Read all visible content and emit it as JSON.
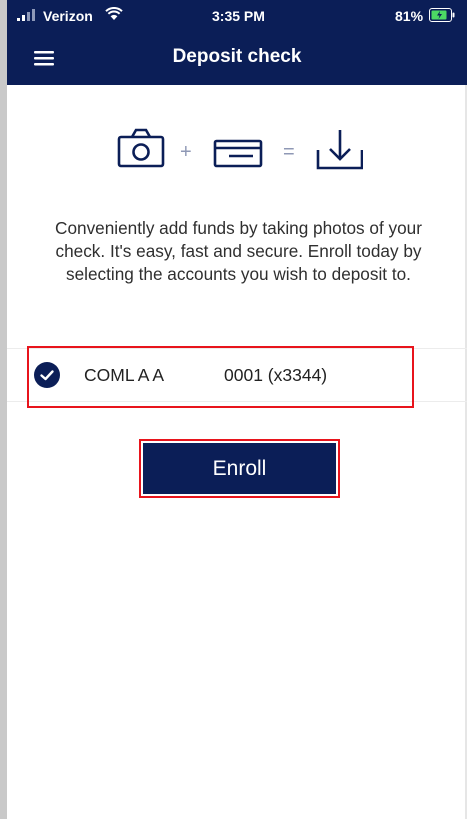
{
  "status_bar": {
    "carrier": "Verizon",
    "time": "3:35 PM",
    "battery_percent": "81%"
  },
  "header": {
    "title": "Deposit check",
    "menu_icon": "hamburger-menu-icon",
    "background_color": "#0b1e57"
  },
  "hero": {
    "icons": [
      "camera-icon",
      "check-card-icon",
      "download-icon"
    ],
    "plus": "+",
    "equals": "="
  },
  "description": "Conveniently add funds by taking photos of your check. It's easy, fast and secure. Enroll today by selecting the accounts you wish to deposit to.",
  "accounts": [
    {
      "name": "COML A A",
      "number": "0001 (x3344)",
      "selected": true
    }
  ],
  "enroll_button": {
    "label": "Enroll",
    "background_color": "#0b1e57"
  },
  "highlight_color": "#e8141c"
}
